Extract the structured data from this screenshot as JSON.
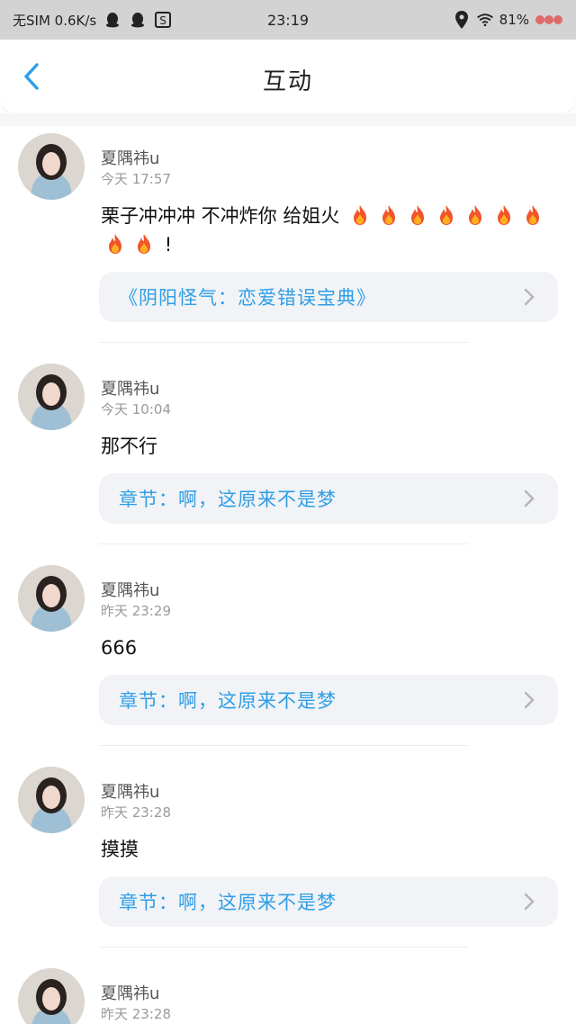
{
  "status_bar": {
    "left_text": "无SIM 0.6K/s",
    "time": "23:19",
    "battery": "81%"
  },
  "header": {
    "title": "互动"
  },
  "colors": {
    "link": "#2f9ee6",
    "status_bar_bg": "#d3d3d3"
  },
  "comments": [
    {
      "username": "夏隅祎u",
      "time": "今天 17:57",
      "text_pre": "栗子冲冲冲 不冲炸你 给姐火",
      "fire_count": 9,
      "text_post": "!",
      "link": "《阴阳怪气：恋爱错误宝典》"
    },
    {
      "username": "夏隅祎u",
      "time": "今天 10:04",
      "text": "那不行",
      "link": "章节：啊，这原来不是梦"
    },
    {
      "username": "夏隅祎u",
      "time": "昨天 23:29",
      "text": "666",
      "link": "章节：啊，这原来不是梦"
    },
    {
      "username": "夏隅祎u",
      "time": "昨天 23:28",
      "text": "摸摸",
      "link": "章节：啊，这原来不是梦"
    },
    {
      "username": "夏隅祎u",
      "time": "昨天 23:28"
    }
  ]
}
